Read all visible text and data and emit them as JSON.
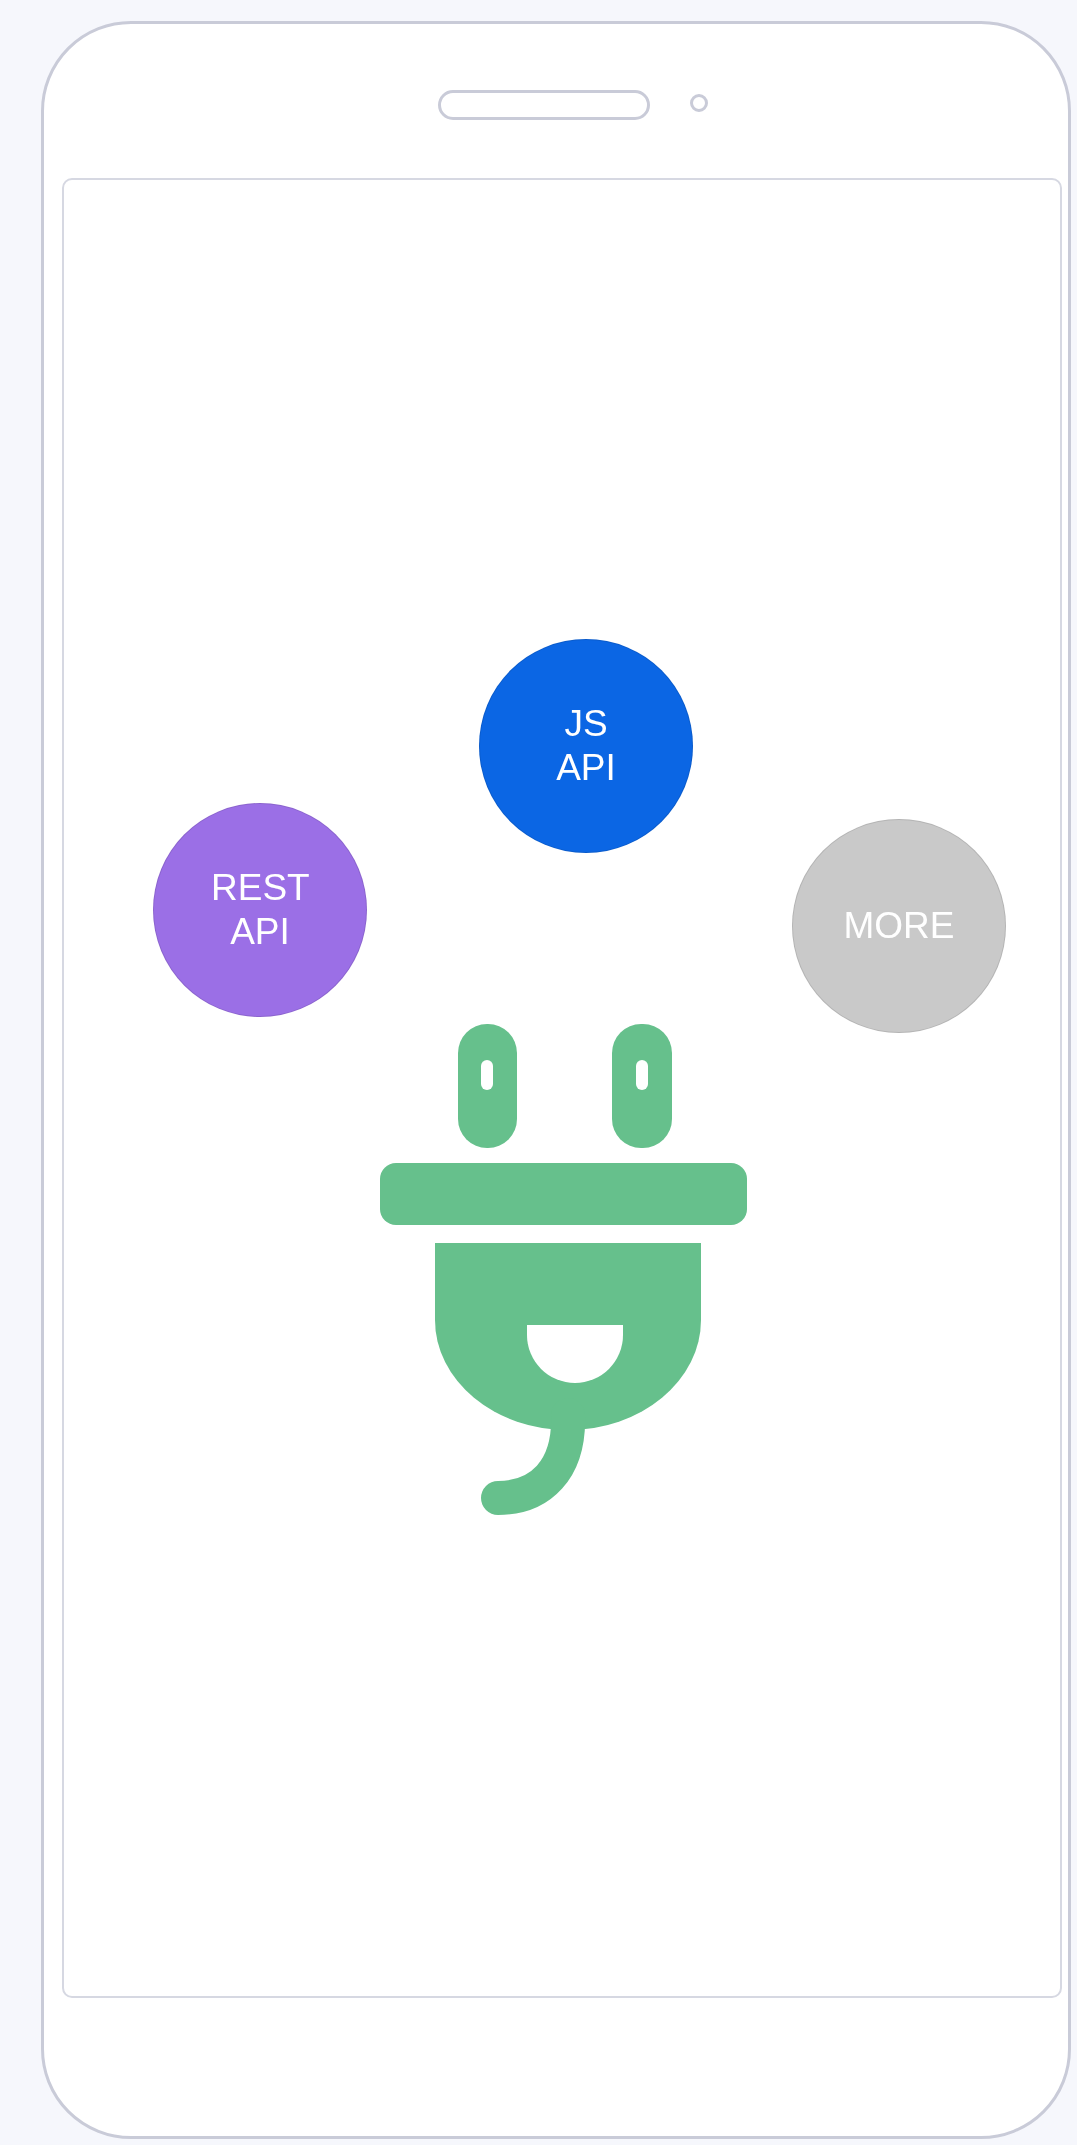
{
  "bubbles": [
    {
      "label": "JS API",
      "color": "#0b66e4"
    },
    {
      "label": "REST API",
      "color": "#9b6fe6"
    },
    {
      "label": "MORE",
      "color": "#c9c9c9"
    }
  ]
}
